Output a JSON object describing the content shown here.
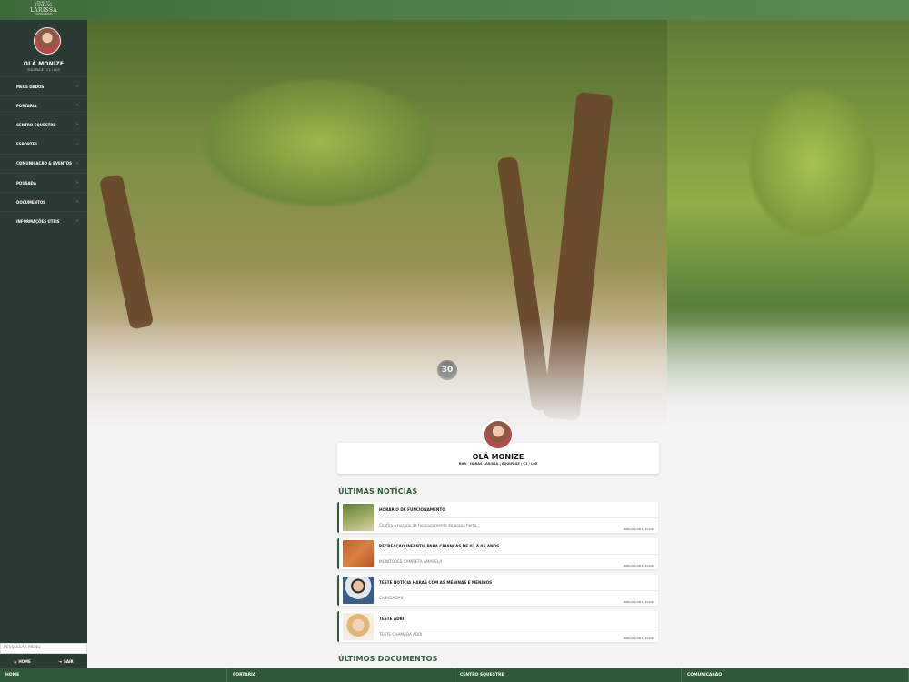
{
  "brand": {
    "line1": "FAMILY",
    "line2": "HARAS",
    "line3": "LARISSA",
    "line4": "CONDOMÍNIO"
  },
  "sidebar": {
    "greeting": "OLÁ MONIZE",
    "subtitle": "EQUIPAGE | C1 / L05",
    "items": [
      {
        "label": "MEUS DADOS"
      },
      {
        "label": "PORTARIA"
      },
      {
        "label": "CENTRO EQUESTRE"
      },
      {
        "label": "ESPORTES"
      },
      {
        "label": "COMUNICAÇÃO & EVENTOS"
      },
      {
        "label": "POUSADA"
      },
      {
        "label": "DOCUMENTOS"
      },
      {
        "label": "INFORMAÇÕES ÚTEIS"
      }
    ],
    "search_placeholder": "PESQUISAR MENU",
    "home_label": "HOME",
    "exit_label": "SAIR"
  },
  "hero": {
    "sign_text": "30"
  },
  "profile": {
    "greeting": "OLÁ MONIZE",
    "info": "RHR - HARAS LARISSA | EQUIPAGE | C1 / L05"
  },
  "news": {
    "title": "ÚLTIMAS NOTÍCIAS",
    "items": [
      {
        "title": "HORÁRIO DE FUNCIONAMENTO",
        "desc": "Confira o horário de funcionamento da nossa horta.",
        "date": "PUBLICADO EM 12.10.2022",
        "thumb": "horse-photo"
      },
      {
        "title": "RECREAÇÃO INFANTIL PARA CRIANÇAS DE 02 À 05 ANOS",
        "desc": "MONITORES CAMISETA AMARELA",
        "date": "PUBLICADO EM 30.09.2022",
        "thumb": "clay-court-photo"
      },
      {
        "title": "TESTE NOTÍCIA HARAS COM AS MENINAS E MENINOS",
        "desc": "CASADADAS",
        "date": "PUBLICADO EM 27.09.2022",
        "thumb": "man-portrait-photo"
      },
      {
        "title": "TESTE ADRI",
        "desc": "TESTE CHAMADA ADRI",
        "date": "PUBLICADO EM 27.09.2022",
        "thumb": "woman-portrait-photo"
      }
    ]
  },
  "documents": {
    "title": "ÚLTIMOS DOCUMENTOS"
  },
  "bottom_tabs": [
    {
      "label": "HOME"
    },
    {
      "label": "PORTARIA"
    },
    {
      "label": "CENTRO EQUESTRE"
    },
    {
      "label": "COMUNICAÇÃO"
    }
  ],
  "colors": {
    "primary": "#2f5a3a",
    "sidebar": "#2b3a33"
  }
}
